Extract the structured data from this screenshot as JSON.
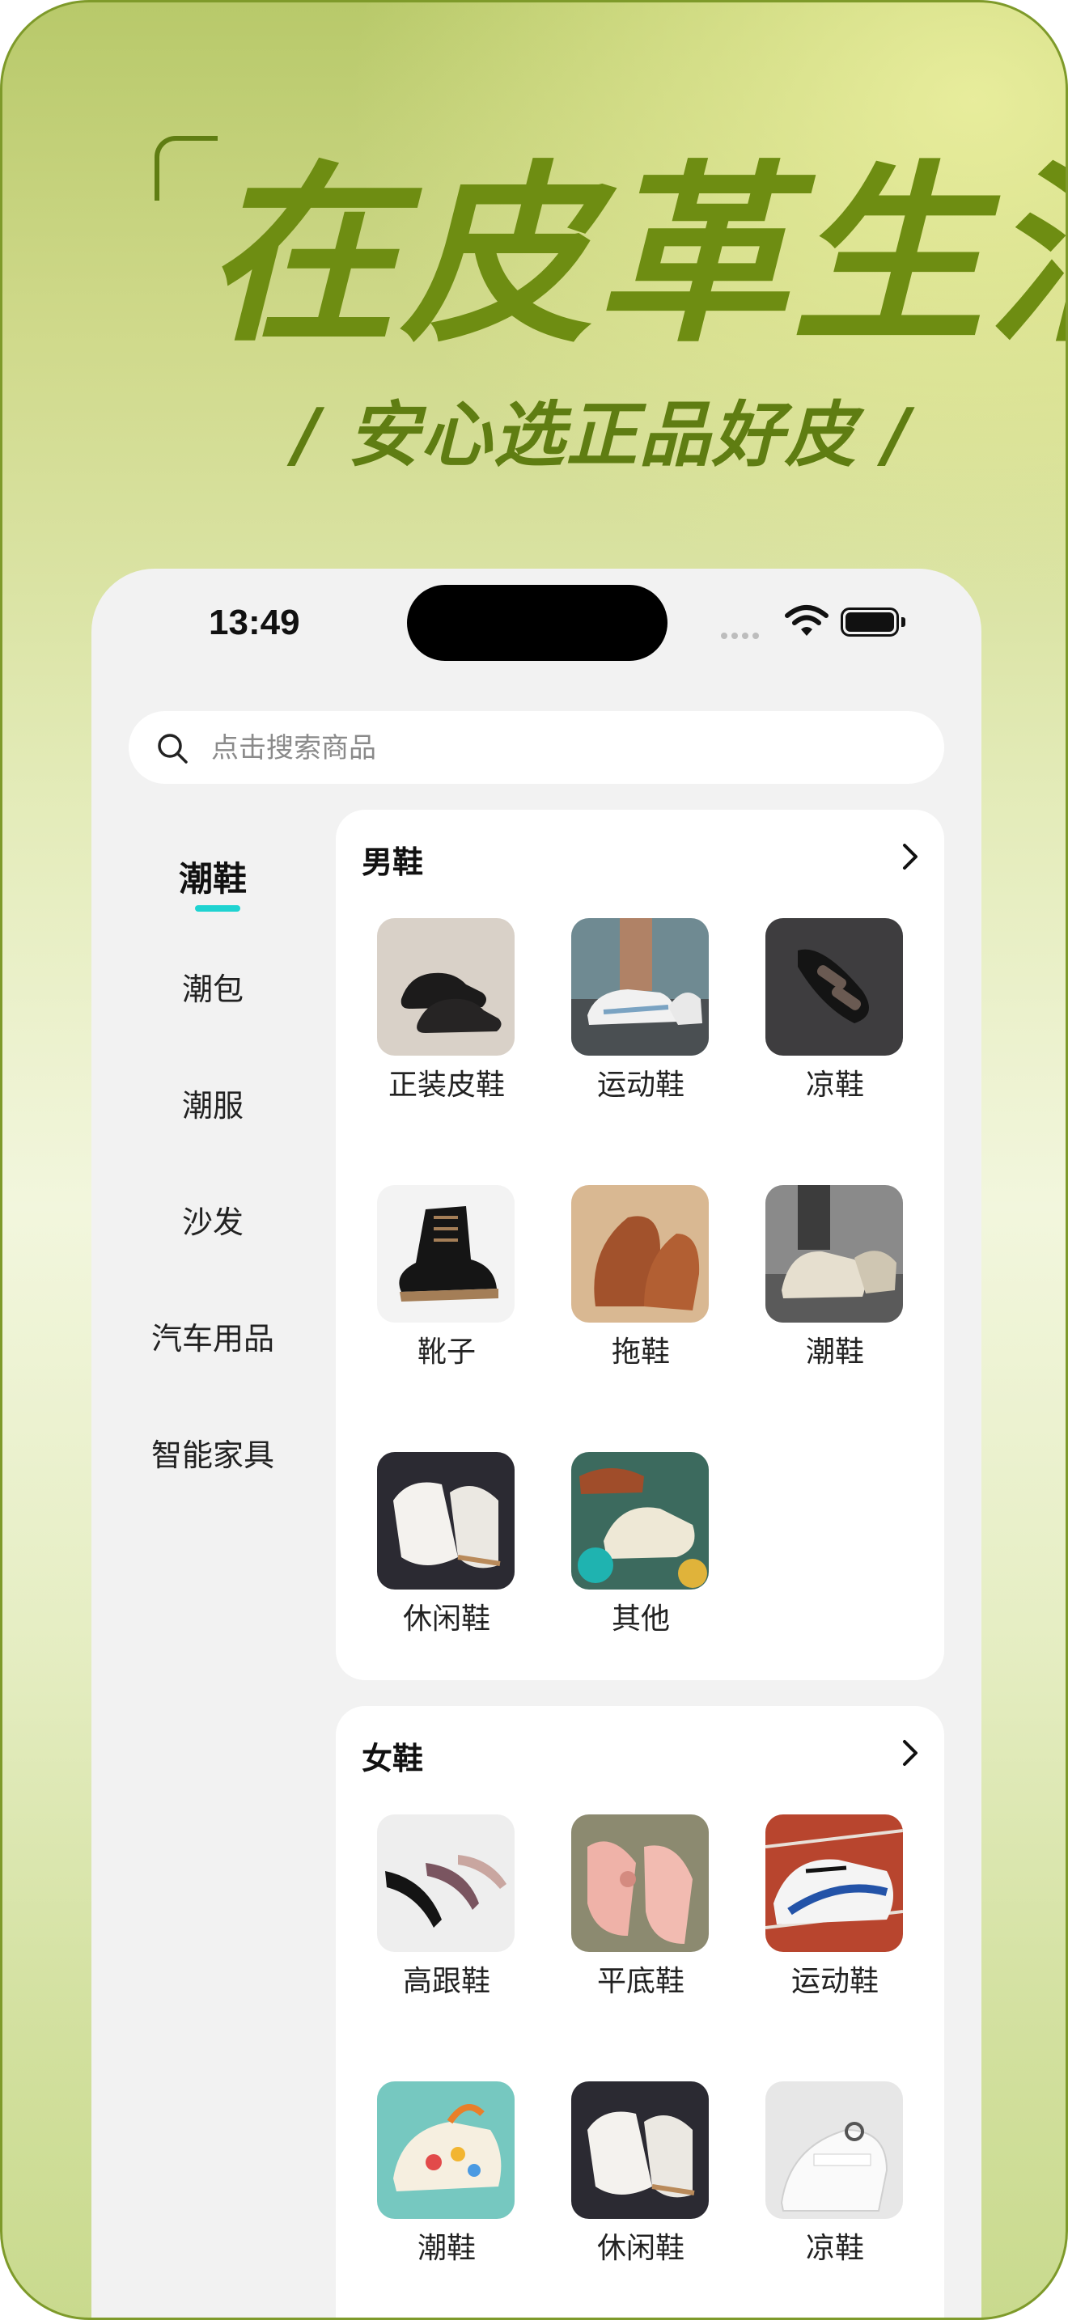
{
  "poster": {
    "headline": "在皮革生活",
    "subline": "/ 安心选正品好皮 /"
  },
  "status_bar": {
    "time": "13:49"
  },
  "search": {
    "placeholder": "点击搜索商品"
  },
  "sidebar": {
    "items": [
      {
        "label": "潮鞋",
        "active": true
      },
      {
        "label": "潮包",
        "active": false
      },
      {
        "label": "潮服",
        "active": false
      },
      {
        "label": "沙发",
        "active": false
      },
      {
        "label": "汽车用品",
        "active": false
      },
      {
        "label": "智能家具",
        "active": false
      }
    ],
    "accent_color": "#1fd3d1"
  },
  "sections": [
    {
      "title": "男鞋",
      "items": [
        {
          "label": "正装皮鞋",
          "icon": "dress-shoe-image"
        },
        {
          "label": "运动鞋",
          "icon": "sneaker-image"
        },
        {
          "label": "凉鞋",
          "icon": "sandal-image"
        },
        {
          "label": "靴子",
          "icon": "boot-image"
        },
        {
          "label": "拖鞋",
          "icon": "slipper-image"
        },
        {
          "label": "潮鞋",
          "icon": "trend-shoe-image"
        },
        {
          "label": "休闲鞋",
          "icon": "casual-shoe-image"
        },
        {
          "label": "其他",
          "icon": "other-shoe-image"
        }
      ]
    },
    {
      "title": "女鞋",
      "items": [
        {
          "label": "高跟鞋",
          "icon": "high-heel-image"
        },
        {
          "label": "平底鞋",
          "icon": "flat-shoe-image"
        },
        {
          "label": "运动鞋",
          "icon": "sneaker-image"
        },
        {
          "label": "潮鞋",
          "icon": "trend-shoe-image"
        },
        {
          "label": "休闲鞋",
          "icon": "casual-shoe-image"
        },
        {
          "label": "凉鞋",
          "icon": "sandal-image"
        }
      ]
    }
  ],
  "colors": {
    "headline": "#6e8d12",
    "background_top": "#b8c96a",
    "background_mid": "#f2f6dd"
  }
}
